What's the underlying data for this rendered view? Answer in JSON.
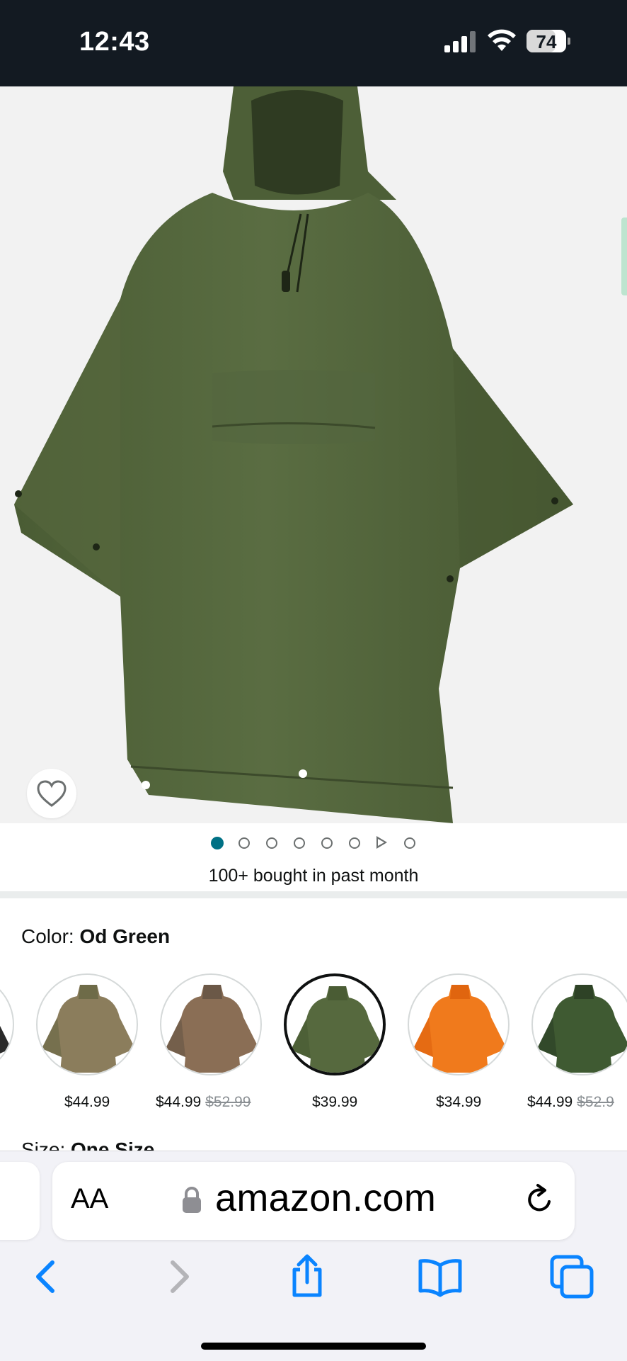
{
  "status_bar": {
    "time": "12:43",
    "battery": "74",
    "battery_level": 0.74
  },
  "product": {
    "bought_text": "100+ bought in past month",
    "color_label": "Color:",
    "color_value": "Od Green",
    "size_label": "Size:",
    "size_value": "One Size",
    "image_dots": {
      "count": 7,
      "active_index": 0,
      "video_after_index": 5
    },
    "swatches": [
      {
        "name": "black",
        "price": "",
        "colors": [
          "#2a2a2a",
          "#3a3a3a"
        ]
      },
      {
        "name": "multicam",
        "price": "$44.99",
        "old_price": "",
        "colors": [
          "#8b7d5c",
          "#6e6b48"
        ]
      },
      {
        "name": "desert-camo",
        "price": "$44.99",
        "old_price": "$52.99",
        "colors": [
          "#8a6e55",
          "#6b5847"
        ]
      },
      {
        "name": "od-green",
        "price": "$39.99",
        "old_price": "",
        "colors": [
          "#56693e",
          "#4a5c34"
        ],
        "selected": true
      },
      {
        "name": "orange",
        "price": "$34.99",
        "old_price": "",
        "colors": [
          "#f07a1c",
          "#e0650f"
        ]
      },
      {
        "name": "woodland-camo",
        "price": "$44.99",
        "old_price": "$52.9",
        "colors": [
          "#3f5a32",
          "#2e4226"
        ]
      }
    ]
  },
  "browser": {
    "aa_label": "AA",
    "url": "amazon.com"
  },
  "colors": {
    "status_bg": "#131a22",
    "link_blue": "#0a84ff",
    "active_dot": "#007185",
    "poncho": "#4f6239"
  },
  "icons": [
    "wifi-icon",
    "signal-icon",
    "battery-icon",
    "heart-icon",
    "lock-icon",
    "reload-icon",
    "back-icon",
    "forward-icon",
    "share-icon",
    "bookmarks-icon",
    "tabs-icon"
  ]
}
